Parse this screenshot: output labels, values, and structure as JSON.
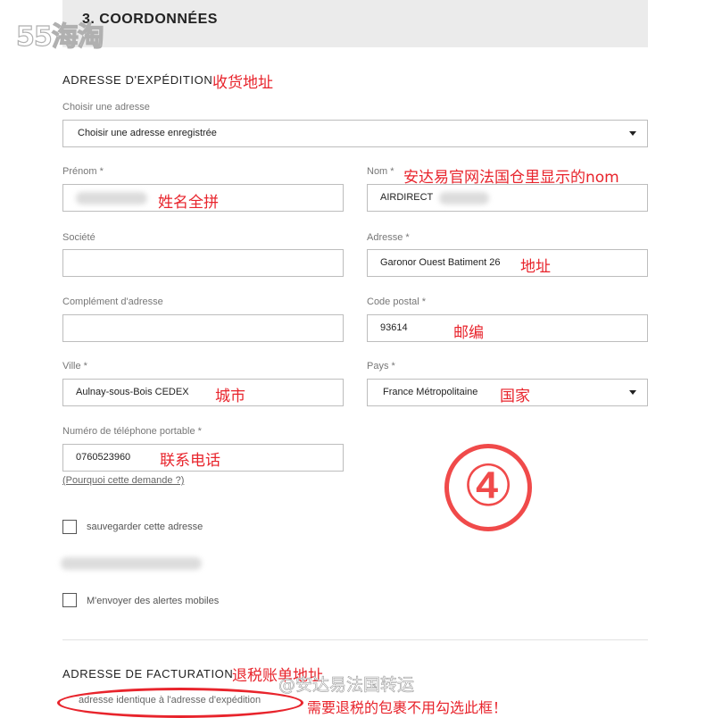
{
  "watermark": {
    "logo": "55海淘",
    "weibo": "@安达易法国转运"
  },
  "section": {
    "title": "3. COORDONNÉES"
  },
  "shipping": {
    "heading": "ADRESSE D'EXPÉDITION",
    "heading_note": "收货地址",
    "choose_label": "Choisir une adresse",
    "choose_value": "Choisir une adresse enregistrée"
  },
  "fields": {
    "prenom_label": "Prénom *",
    "prenom_note": "姓名全拼",
    "nom_label": "Nom *",
    "nom_note": "安达易官网法国仓里显示的nom",
    "nom_value": "AIRDIRECT",
    "societe_label": "Société",
    "adresse_label": "Adresse *",
    "adresse_value": "Garonor Ouest Batiment 26",
    "adresse_note": "地址",
    "complement_label": "Complément d'adresse",
    "code_label": "Code postal *",
    "code_value": "93614",
    "code_note": "邮编",
    "ville_label": "Ville *",
    "ville_value": "Aulnay-sous-Bois CEDEX",
    "ville_note": "城市",
    "pays_label": "Pays *",
    "pays_value": "France Métropolitaine",
    "pays_note": "国家",
    "tel_label": "Numéro de téléphone portable *",
    "tel_value": "0760523960",
    "tel_note": "联系电话",
    "why_link": "(Pourquoi cette demande ?)"
  },
  "options": {
    "save_address": "sauvegarder cette adresse",
    "mobile_alerts": "M'envoyer des alertes mobiles"
  },
  "step_marker": "④",
  "billing": {
    "heading": "ADRESSE DE FACTURATION",
    "heading_note": "退税账单地址",
    "same_address": "adresse identique à l'adresse d'expédition",
    "same_note": "需要退税的包裹不用勾选此框！"
  },
  "colors": {
    "annotation": "#e8242c",
    "header_bg": "#ebebeb"
  }
}
